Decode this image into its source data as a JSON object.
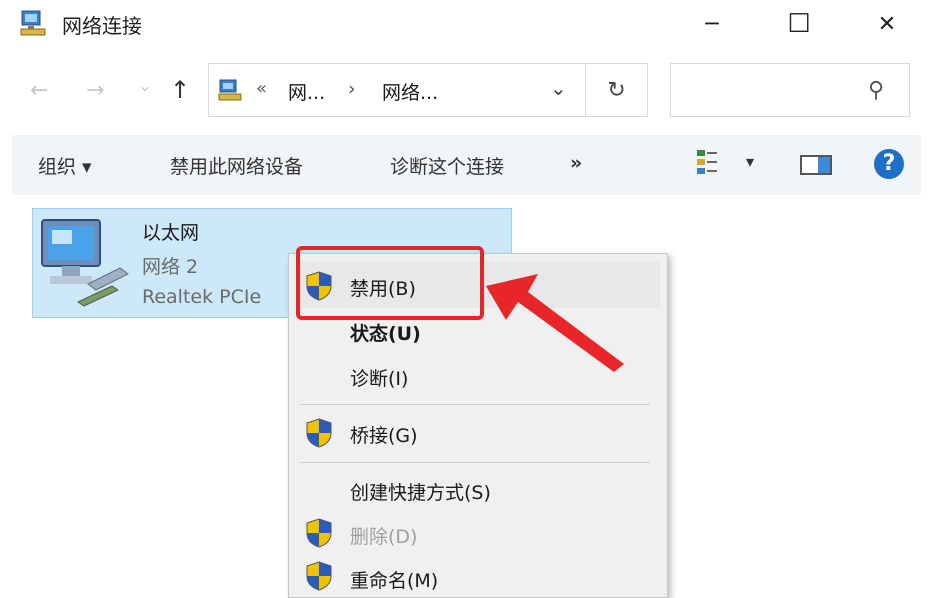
{
  "window": {
    "title": "网络连接",
    "minimize_glyph": "─",
    "maximize_glyph": "☐",
    "close_glyph": "✕"
  },
  "nav": {
    "back_glyph": "←",
    "forward_glyph": "→",
    "recent_glyph": "⌄",
    "up_glyph": "↑"
  },
  "address": {
    "overflow": "«",
    "crumb1": "网...",
    "sep": "›",
    "crumb2": "网络...",
    "dropdown_glyph": "⌄",
    "refresh_glyph": "↻"
  },
  "search": {
    "placeholder": "",
    "icon_glyph": "⚲"
  },
  "toolbar": {
    "organize": "组织 ▾",
    "disable_device": "禁用此网络设备",
    "diagnose": "诊断这个连接",
    "more": "»",
    "view_dropdown": "▾",
    "help": "?"
  },
  "item": {
    "name": "以太网",
    "network": "网络 2",
    "adapter": "Realtek PCIe"
  },
  "context_menu": {
    "items": [
      {
        "label": "禁用(B)",
        "shield": true,
        "bold": false,
        "disabled": false
      },
      {
        "label": "状态(U)",
        "shield": false,
        "bold": true,
        "disabled": false
      },
      {
        "label": "诊断(I)",
        "shield": false,
        "bold": false,
        "disabled": false
      },
      {
        "label": "桥接(G)",
        "shield": true,
        "bold": false,
        "disabled": false
      },
      {
        "label": "创建快捷方式(S)",
        "shield": false,
        "bold": false,
        "disabled": false
      },
      {
        "label": "删除(D)",
        "shield": true,
        "bold": false,
        "disabled": true
      },
      {
        "label": "重命名(M)",
        "shield": true,
        "bold": false,
        "disabled": false
      }
    ]
  },
  "colors": {
    "annotation_red": "#e8262a",
    "selection_blue": "#cde8f8",
    "help_blue": "#1e6fc8"
  }
}
